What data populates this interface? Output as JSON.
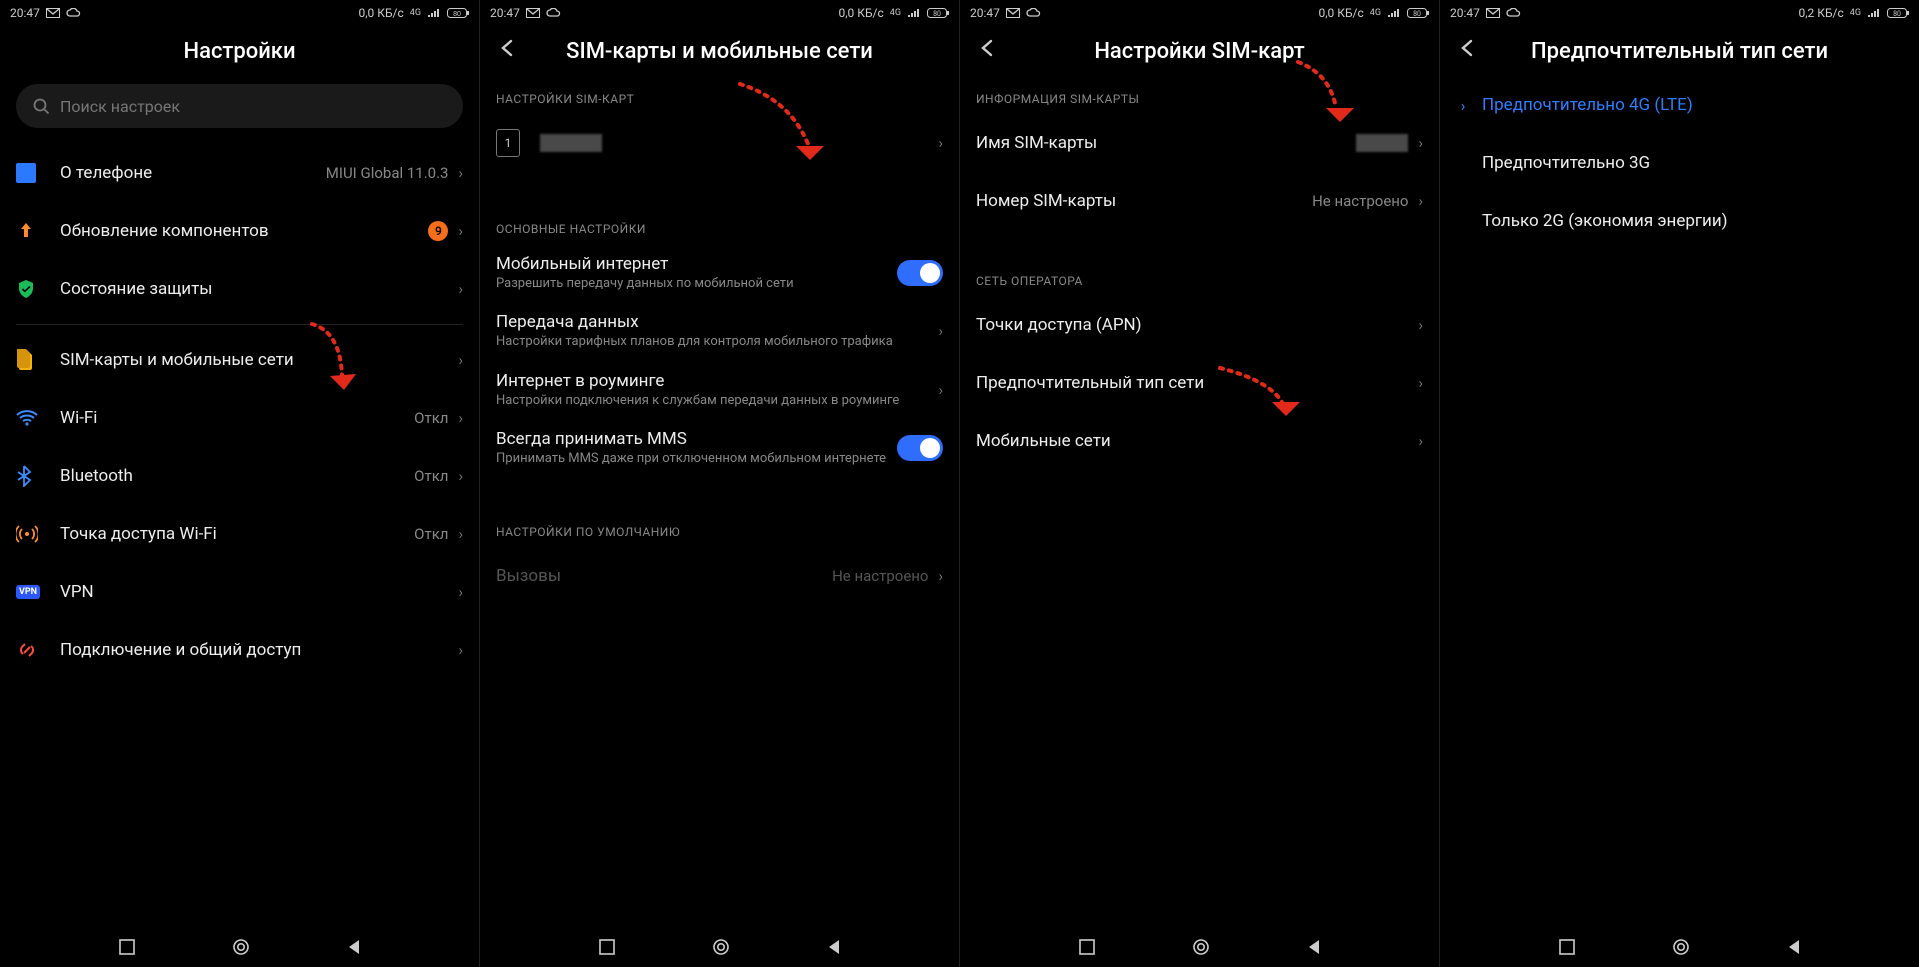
{
  "status": {
    "time": "20:47",
    "data1": "0,0 КБ/с",
    "data4": "0,2 КБ/с",
    "net": "4G"
  },
  "p1": {
    "title": "Настройки",
    "search_placeholder": "Поиск настроек",
    "items": {
      "about": {
        "label": "О телефоне",
        "value": "MIUI Global 11.0.3"
      },
      "update": {
        "label": "Обновление компонентов",
        "badge": "9"
      },
      "security": {
        "label": "Состояние защиты"
      },
      "sim": {
        "label": "SIM-карты и мобильные сети"
      },
      "wifi": {
        "label": "Wi-Fi",
        "value": "Откл"
      },
      "bt": {
        "label": "Bluetooth",
        "value": "Откл"
      },
      "hotspot": {
        "label": "Точка доступа Wi-Fi",
        "value": "Откл"
      },
      "vpn": {
        "label": "VPN"
      },
      "share": {
        "label": "Подключение и общий доступ"
      }
    }
  },
  "p2": {
    "title": "SIM-карты и мобильные сети",
    "sec_sim": "НАСТРОЙКИ SIM-КАРТ",
    "sim_slot": "1",
    "sec_main": "ОСНОВНЫЕ НАСТРОЙКИ",
    "mobile_internet": {
      "title": "Мобильный интернет",
      "sub": "Разрешить передачу данных по мобильной сети"
    },
    "data_usage": {
      "title": "Передача данных",
      "sub": "Настройки тарифных планов для контроля мобильного трафика"
    },
    "roaming": {
      "title": "Интернет в роуминге",
      "sub": "Настройки подключения к службам передачи данных в роуминге"
    },
    "mms": {
      "title": "Всегда принимать MMS",
      "sub": "Принимать MMS даже при отключенном мобильном интернете"
    },
    "sec_default": "НАСТРОЙКИ ПО УМОЛЧАНИЮ",
    "calls": {
      "title": "Вызовы",
      "value": "Не настроено"
    }
  },
  "p3": {
    "title": "Настройки SIM-карт",
    "sec_info": "ИНФОРМАЦИЯ SIM-КАРТЫ",
    "sim_name": {
      "label": "Имя SIM-карты"
    },
    "sim_number": {
      "label": "Номер SIM-карты",
      "value": "Не настроено"
    },
    "sec_op": "СЕТЬ ОПЕРАТОРА",
    "apn": {
      "label": "Точки доступа (APN)"
    },
    "pref": {
      "label": "Предпочтительный тип сети"
    },
    "mnet": {
      "label": "Мобильные сети"
    }
  },
  "p4": {
    "title": "Предпочтительный тип сети",
    "opt4g": "Предпочтительно 4G (LTE)",
    "opt3g": "Предпочтительно 3G",
    "opt2g": "Только 2G (экономия энергии)"
  }
}
